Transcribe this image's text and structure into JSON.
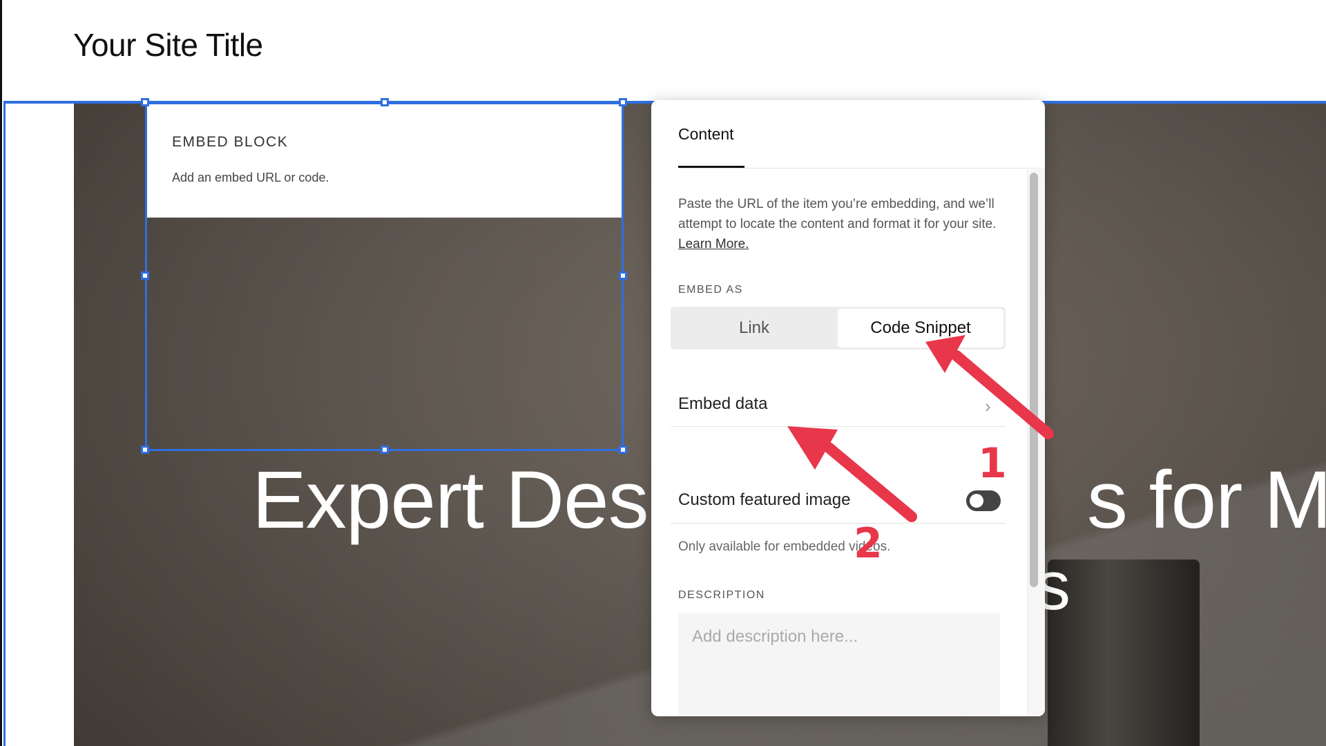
{
  "site": {
    "title": "Your Site Title"
  },
  "hero": {
    "heading": "Expert Desi",
    "heading_right": "s for Mo",
    "heading_line2": "s"
  },
  "embed_block": {
    "title": "EMBED BLOCK",
    "subtitle": "Add an embed URL or code."
  },
  "panel": {
    "tab": "Content",
    "description": "Paste the URL of the item you’re embedding, and we’ll attempt to locate the content and format it for your site.",
    "learn_more": "Learn More.",
    "embed_as_label": "EMBED AS",
    "segment_options": [
      "Link",
      "Code Snippet"
    ],
    "selected_segment": "Code Snippet",
    "embed_data_label": "Embed data",
    "custom_image_label": "Custom featured image",
    "custom_image_toggle": "off",
    "custom_image_hint": "Only available for embedded videos.",
    "description_label": "DESCRIPTION",
    "description_placeholder": "Add description here..."
  },
  "annotations": {
    "marker_1": "1",
    "marker_2": "2",
    "color": "#e8364a"
  },
  "colors": {
    "selection": "#2f6fe0",
    "panel_bg": "#ffffff"
  },
  "icons": {
    "chevron": "chevron-right-icon"
  }
}
